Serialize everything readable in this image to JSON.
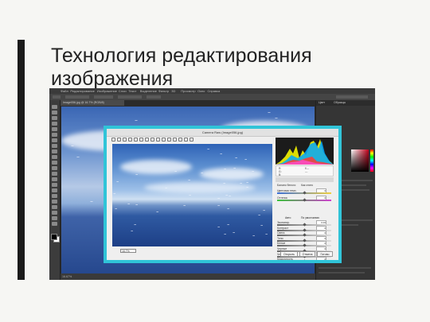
{
  "slide": {
    "title": "Технология редактирования изображения"
  },
  "photoshop": {
    "menu": [
      "Файл",
      "Редактирование",
      "Изображение",
      "Слои",
      "Текст",
      "Выделение",
      "Фильтр",
      "3D",
      "Просмотр",
      "Окно",
      "Справка"
    ],
    "document_tab": "Image056.jpg @ 16.7% (RGB/8)",
    "status_zoom": "16.67%",
    "panel_tabs": [
      "Цвет",
      "Образцы"
    ]
  },
  "camera_raw": {
    "title": "Camera Raw (Image056.jpg)",
    "zoom": "16.7%",
    "white_balance_label": "Баланс белого:",
    "white_balance_value": "Как снято",
    "sliders": [
      {
        "label": "Цветовая темп.",
        "value": "0",
        "pos": 0.5
      },
      {
        "label": "Оттенок",
        "value": "0",
        "pos": 0.5
      },
      {
        "label": "Экспонир.",
        "value": "0.00",
        "pos": 0.5
      },
      {
        "label": "Контраст",
        "value": "0",
        "pos": 0.5
      },
      {
        "label": "Света",
        "value": "0",
        "pos": 0.5
      },
      {
        "label": "Тени",
        "value": "0",
        "pos": 0.5
      },
      {
        "label": "Белые",
        "value": "0",
        "pos": 0.5
      },
      {
        "label": "Черные",
        "value": "0",
        "pos": 0.5
      },
      {
        "label": "Четкость",
        "value": "0",
        "pos": 0.5
      },
      {
        "label": "Красочность",
        "value": "0",
        "pos": 0.5
      }
    ],
    "auto_link": "Авто",
    "default_link": "По умолчанию",
    "ok_button": "Открыть",
    "cancel_button": "Отмена",
    "done_button": "Готово",
    "info": {
      "r": "R:",
      "g": "G:",
      "b": "B:",
      "f": "f/---",
      "s": "---"
    }
  },
  "colors": {
    "dialog_highlight": "#30c4d8",
    "ps_dark": "#2b2b2b"
  }
}
